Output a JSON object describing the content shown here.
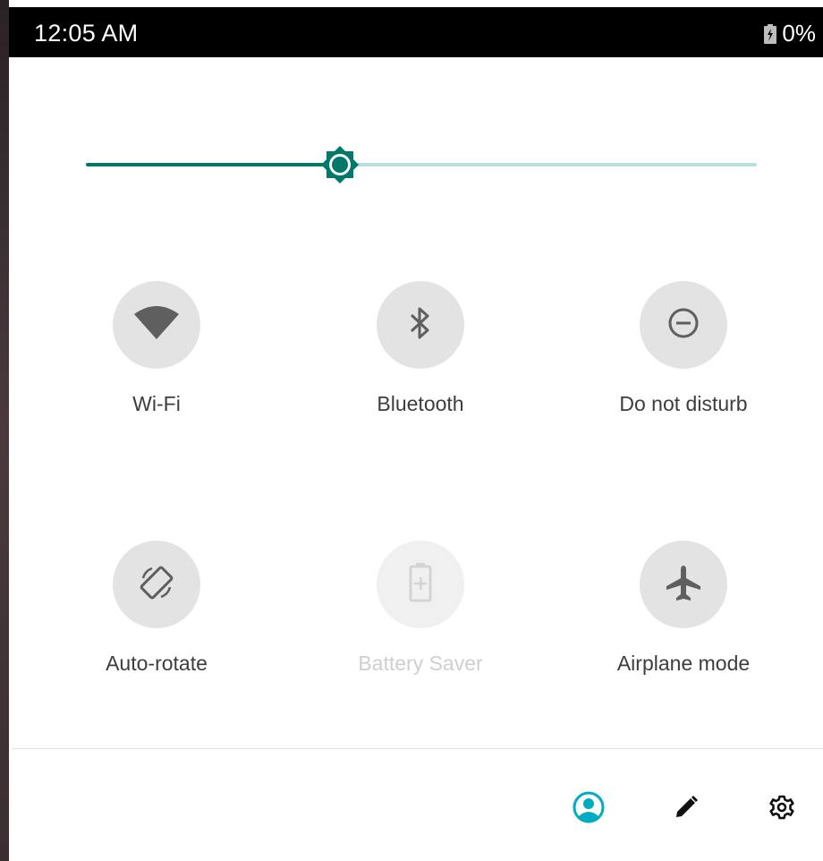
{
  "status_bar": {
    "time": "12:05 AM",
    "battery_percent": "0%",
    "battery_icon": "battery-charging-icon"
  },
  "brightness": {
    "level_fraction": 0.378,
    "thumb_icon": "brightness-icon",
    "active_color": "#00796b",
    "inactive_color": "#b9dfdc"
  },
  "tiles": [
    {
      "label": "Wi-Fi",
      "icon": "wifi-icon",
      "enabled": true
    },
    {
      "label": "Bluetooth",
      "icon": "bluetooth-icon",
      "enabled": true
    },
    {
      "label": "Do not disturb",
      "icon": "do-not-disturb-icon",
      "enabled": true
    },
    {
      "label": "Auto-rotate",
      "icon": "auto-rotate-icon",
      "enabled": true
    },
    {
      "label": "Battery Saver",
      "icon": "battery-saver-icon",
      "enabled": false
    },
    {
      "label": "Airplane mode",
      "icon": "airplane-icon",
      "enabled": true
    }
  ],
  "footer": {
    "user_icon": "user-account-icon",
    "edit_icon": "edit-pencil-icon",
    "settings_icon": "settings-gear-icon",
    "accent_color": "#00acc1"
  }
}
